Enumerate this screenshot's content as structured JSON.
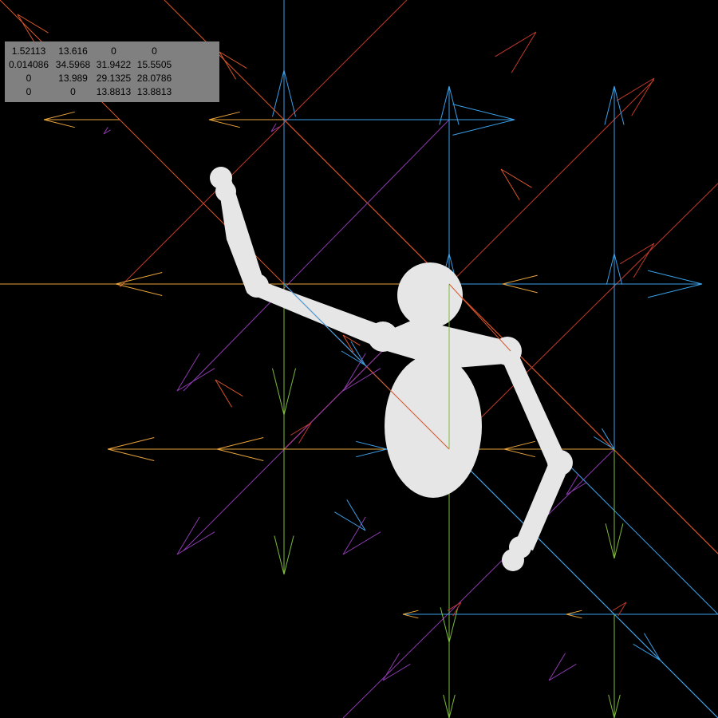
{
  "viewport": {
    "background": "#000000"
  },
  "matrix_overlay": {
    "rows": [
      [
        "1.52113",
        "13.616",
        "0",
        "0"
      ],
      [
        "0.014086",
        "34.5968",
        "31.9422",
        "15.5505"
      ],
      [
        "0",
        "13.989",
        "29.1325",
        "28.0786"
      ],
      [
        "0",
        "0",
        "13.8813",
        "13.8813"
      ]
    ],
    "background": "#808080"
  },
  "vector_field": {
    "colors": {
      "red": "#c0392b",
      "orange": "#e8a33a",
      "blue": "#3aa0e8",
      "purple": "#8e3ab0",
      "green": "#7dbb3a",
      "orange_red": "#d9552a"
    }
  },
  "figure": {
    "color": "#e6e6e6"
  }
}
